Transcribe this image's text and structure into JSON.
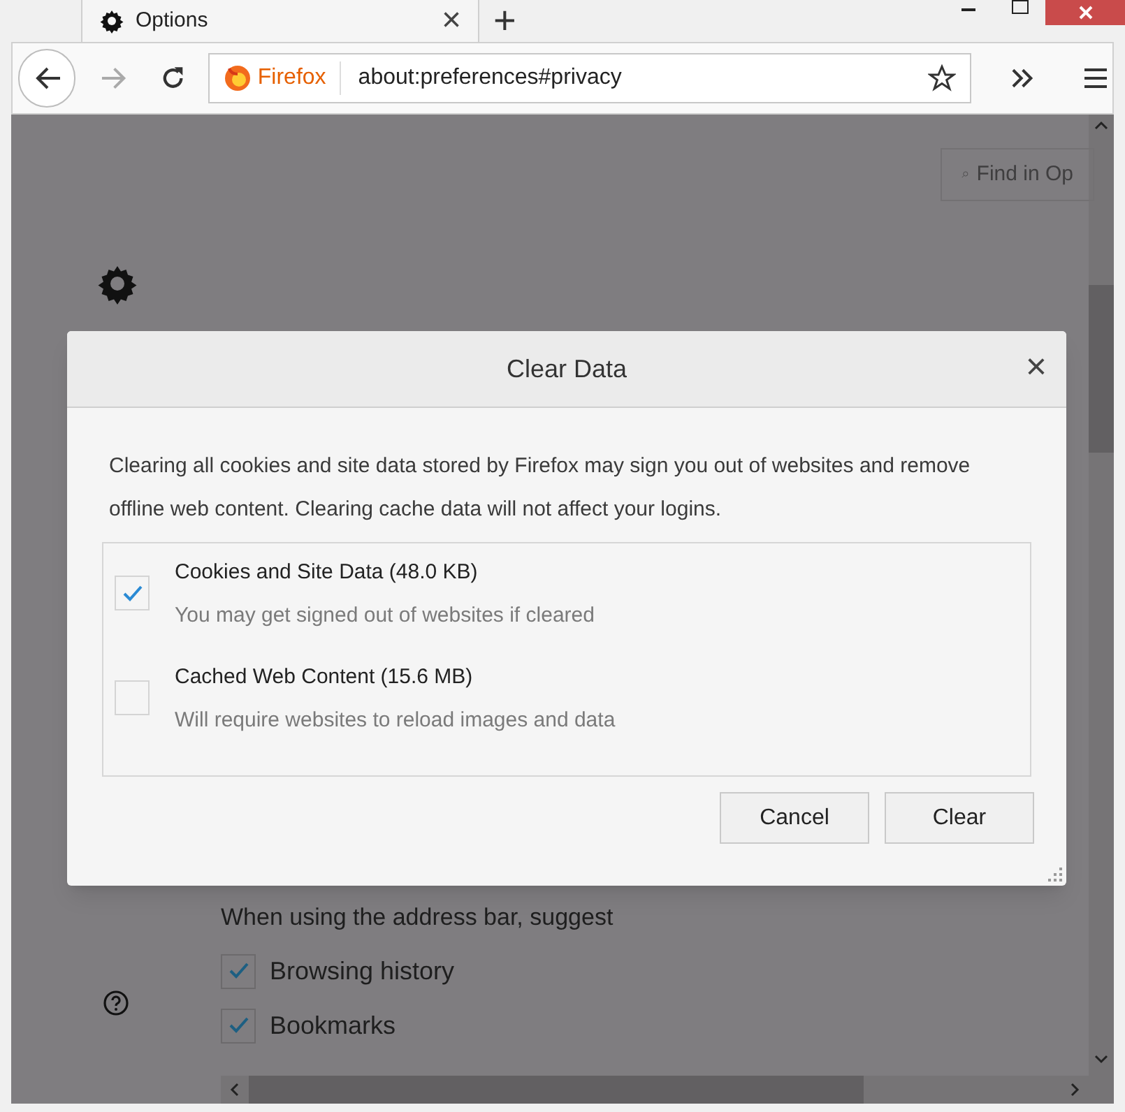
{
  "tab": {
    "title": "Options",
    "close": "×"
  },
  "new_tab": "+",
  "address_bar": {
    "identity": "Firefox",
    "url": "about:preferences#privacy"
  },
  "search": {
    "placeholder": "Find in Op"
  },
  "dialog": {
    "title": "Clear Data",
    "close": "×",
    "description": "Clearing all cookies and site data stored by Firefox may sign you out of websites and remove offline web content. Clearing cache data will not affect your logins.",
    "options": [
      {
        "label": "Cookies and Site Data (48.0 KB)",
        "hint": "You may get signed out of websites if cleared",
        "checked": true
      },
      {
        "label": "Cached Web Content (15.6 MB)",
        "hint": "Will require websites to reload images and data",
        "checked": false
      }
    ],
    "buttons": [
      {
        "label": "Cancel"
      },
      {
        "label": "Clear"
      }
    ]
  },
  "address_bar_suggest": {
    "heading": "When using the address bar, suggest",
    "options": [
      {
        "label": "Browsing history",
        "checked": true
      },
      {
        "label": "Bookmarks",
        "checked": true
      }
    ]
  }
}
